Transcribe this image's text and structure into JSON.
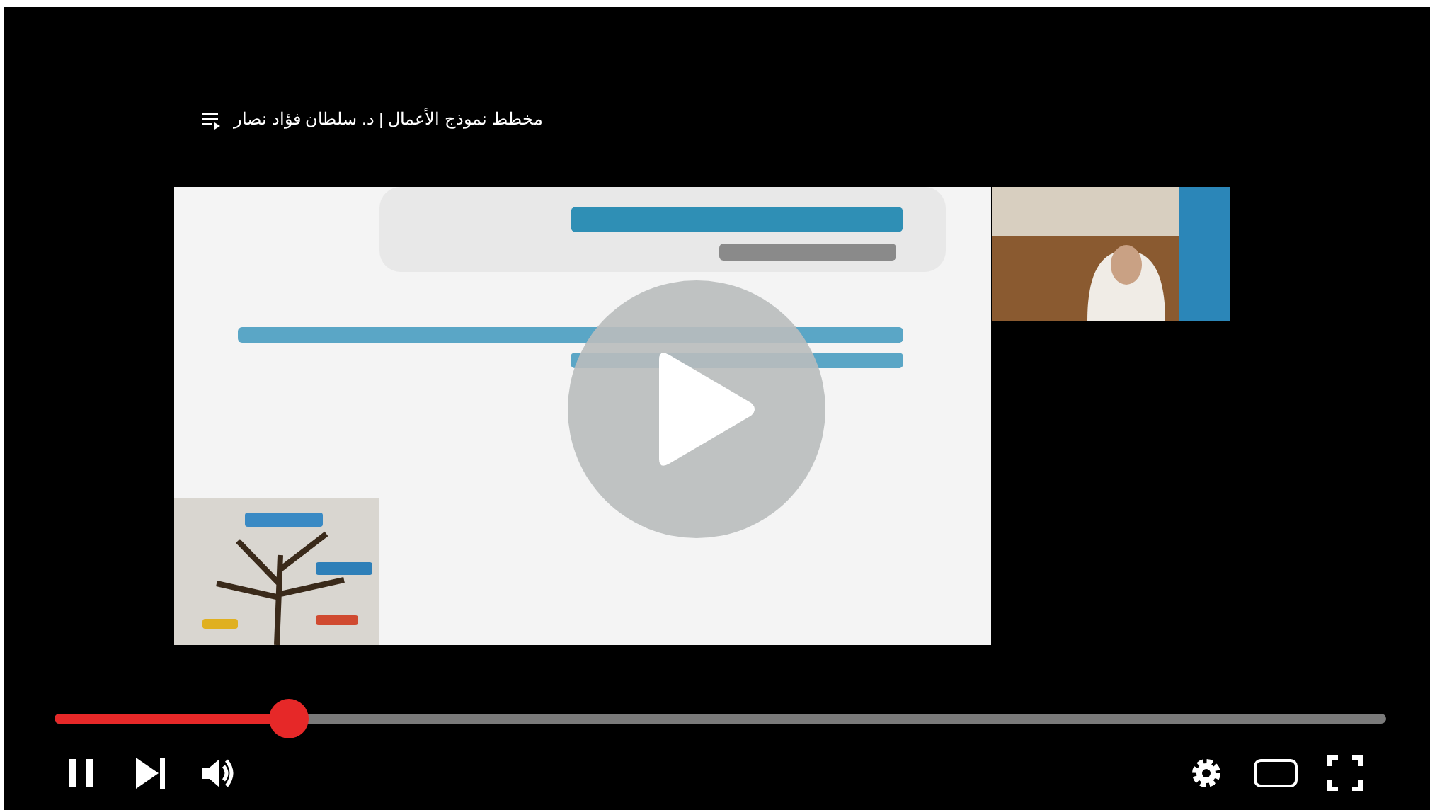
{
  "video": {
    "title": "مخطط نموذج الأعمال | د. سلطان فؤاد نصار"
  },
  "progress": {
    "level": 0.176
  },
  "player": {
    "playing": true
  }
}
